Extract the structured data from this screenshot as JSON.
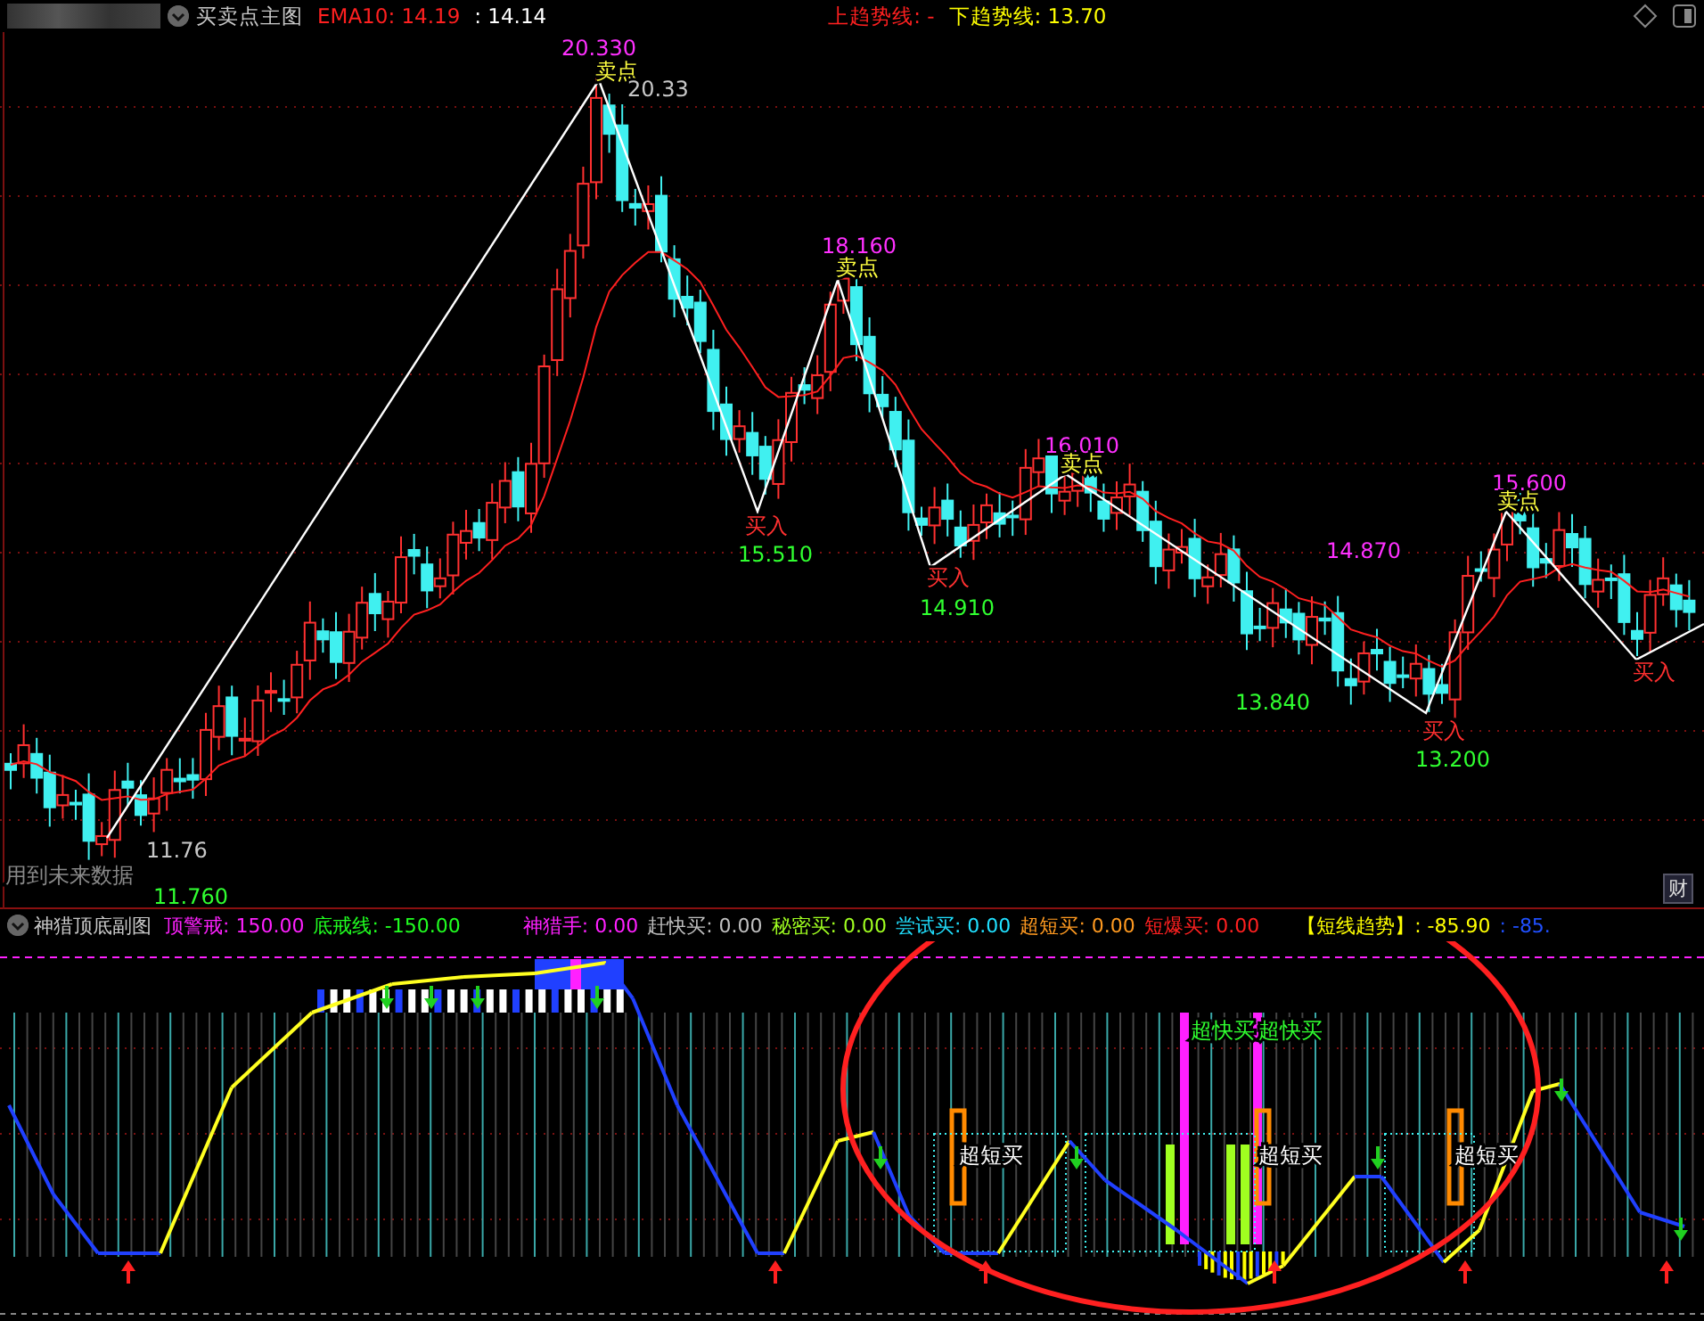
{
  "main_chart": {
    "title": "买卖点主图",
    "header_items": [
      {
        "text": "EMA10: 14.19",
        "color": "#ff2020"
      },
      {
        "text": ": 14.14",
        "color": "#ffffff"
      }
    ],
    "trend_items": [
      {
        "text": "上趋势线: -",
        "color": "#ff2020"
      },
      {
        "text": "下趋势线: 13.70",
        "color": "#ffff00"
      }
    ],
    "annotations": [
      {
        "text": "20.330",
        "kind": "peak"
      },
      {
        "text": "卖点",
        "kind": "sell"
      },
      {
        "text": "20.33",
        "kind": "price"
      },
      {
        "text": "18.160",
        "kind": "peak"
      },
      {
        "text": "卖点",
        "kind": "sell"
      },
      {
        "text": "15.510",
        "kind": "low"
      },
      {
        "text": "买入",
        "kind": "buy"
      },
      {
        "text": "14.910",
        "kind": "low"
      },
      {
        "text": "买入",
        "kind": "buy"
      },
      {
        "text": "16.010",
        "kind": "peak"
      },
      {
        "text": "卖点",
        "kind": "sell"
      },
      {
        "text": "14.870",
        "kind": "peak"
      },
      {
        "text": "13.840",
        "kind": "low"
      },
      {
        "text": "买入",
        "kind": "buy"
      },
      {
        "text": "13.200",
        "kind": "low"
      },
      {
        "text": "15.600",
        "kind": "peak"
      },
      {
        "text": "卖点",
        "kind": "sell"
      },
      {
        "text": "买入",
        "kind": "buy"
      },
      {
        "text": "11.76",
        "kind": "price"
      },
      {
        "text": "用到未来数据",
        "kind": "note"
      },
      {
        "text": "11.760",
        "kind": "low"
      }
    ],
    "badge": "财"
  },
  "sub_chart": {
    "title": "神猎顶底副图",
    "header_items": [
      {
        "text": "顶警戒: 150.00",
        "color": "#ff20ff"
      },
      {
        "text": "底戒线: -150.00",
        "color": "#20ff20"
      },
      {
        "text": "神猎手: 0.00",
        "color": "#ff20ff"
      },
      {
        "text": "赶快买: 0.00",
        "color": "#c0c0c0"
      },
      {
        "text": "秘密买: 0.00",
        "color": "#a0ff20"
      },
      {
        "text": "尝试买: 0.00",
        "color": "#20e0ff"
      },
      {
        "text": "超短买: 0.00",
        "color": "#ff9a20"
      },
      {
        "text": "短爆买: 0.00",
        "color": "#ff2020"
      },
      {
        "text": "【短线趋势】: -85.90",
        "color": "#ffff00"
      },
      {
        "text": ": -85.",
        "color": "#2050ff"
      }
    ],
    "signals": [
      {
        "text": "超快买",
        "kind": "fast"
      },
      {
        "text": "超快买",
        "kind": "fast"
      },
      {
        "text": "超短买",
        "kind": "short"
      },
      {
        "text": "超短买",
        "kind": "short"
      },
      {
        "text": "超短买",
        "kind": "short"
      }
    ]
  }
}
